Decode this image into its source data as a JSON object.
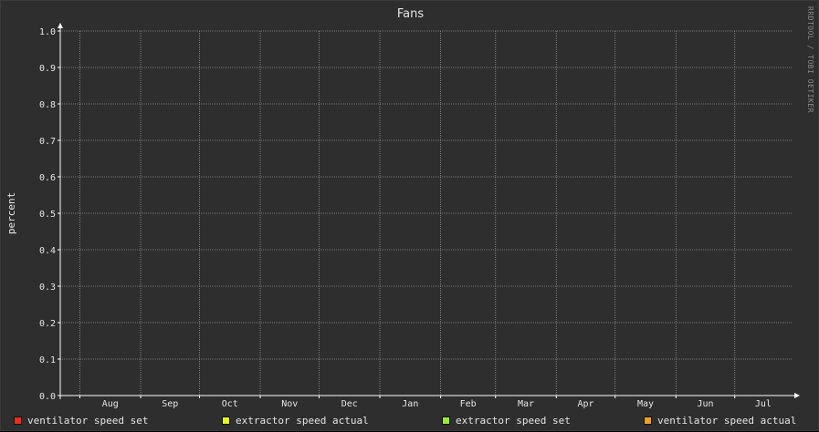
{
  "chart_data": {
    "type": "line",
    "title": "Fans",
    "ylabel": "percent",
    "xlabel": "",
    "ylim": [
      0,
      1.0
    ],
    "yticks": [
      "0.0",
      "0.1",
      "0.2",
      "0.3",
      "0.4",
      "0.5",
      "0.6",
      "0.7",
      "0.8",
      "0.9",
      "1.0"
    ],
    "categories": [
      "Aug",
      "Sep",
      "Oct",
      "Nov",
      "Dec",
      "Jan",
      "Feb",
      "Mar",
      "Apr",
      "May",
      "Jun",
      "Jul"
    ],
    "grid": true,
    "legend_position": "bottom",
    "series": [
      {
        "name": "ventilator speed set",
        "color": "#e8301c",
        "values": []
      },
      {
        "name": "extractor speed actual",
        "color": "#e8f51c",
        "values": []
      },
      {
        "name": "extractor speed set",
        "color": "#9ee83a",
        "values": []
      },
      {
        "name": "ventilator speed actual",
        "color": "#f0a020",
        "values": []
      }
    ]
  },
  "watermark": "RRDTOOL / TOBI OETIKER",
  "colors": {
    "background": "#2e2e2e",
    "grid": "#8c8c8c",
    "axis": "#ffffff",
    "text": "#e6e6e6"
  }
}
